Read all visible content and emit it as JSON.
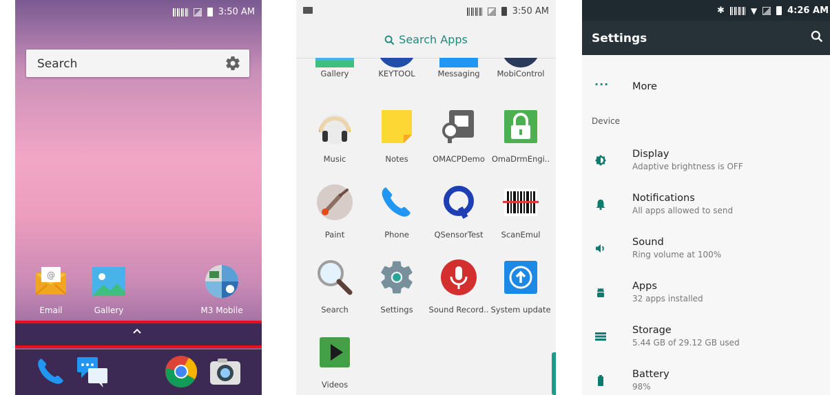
{
  "home": {
    "status_time": "3:50 AM",
    "search_label": "Search",
    "apps": [
      {
        "label": "Email"
      },
      {
        "label": "Gallery"
      },
      {
        "label": "M3 Mobile"
      }
    ]
  },
  "drawer": {
    "status_time": "3:50 AM",
    "search_label": "Search Apps",
    "rows": [
      [
        "Gallery",
        "KEYTOOL",
        "Messaging",
        "MobiControl"
      ],
      [
        "Music",
        "Notes",
        "OMACPDemo",
        "OmaDrmEngi.."
      ],
      [
        "Paint",
        "Phone",
        "QSensorTest",
        "ScanEmul"
      ],
      [
        "Search",
        "Settings",
        "Sound Record..",
        "System update"
      ],
      [
        "Videos"
      ]
    ]
  },
  "settings": {
    "status_time": "4:26 AM",
    "title": "Settings",
    "more_label": "More",
    "category": "Device",
    "items": [
      {
        "title": "Display",
        "subtitle": "Adaptive brightness is OFF",
        "icon": "brightness-icon"
      },
      {
        "title": "Notifications",
        "subtitle": "All apps allowed to send",
        "icon": "bell-icon"
      },
      {
        "title": "Sound",
        "subtitle": "Ring volume at 100%",
        "icon": "volume-icon"
      },
      {
        "title": "Apps",
        "subtitle": "32 apps installed",
        "icon": "android-icon"
      },
      {
        "title": "Storage",
        "subtitle": "5.44 GB of 29.12 GB used",
        "icon": "storage-icon"
      },
      {
        "title": "Battery",
        "subtitle": "98%",
        "icon": "battery-icon"
      }
    ]
  },
  "colors": {
    "accent_teal": "#1e8a7e",
    "highlight_red": "#e8101e",
    "settings_bar": "#263238"
  }
}
